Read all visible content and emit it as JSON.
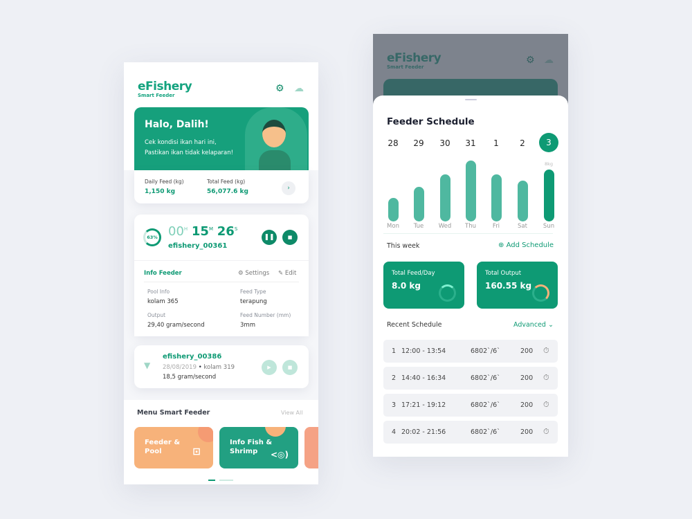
{
  "brand": {
    "name": "eFishery",
    "tagline": "Smart Feeder"
  },
  "colors": {
    "primary": "#0e9a74",
    "orange": "#f7b27a",
    "coral": "#f5a285"
  },
  "home": {
    "greeting": "Halo, Dalih!",
    "subtitle1": "Cek kondisi ikan hari ini,",
    "subtitle2": "Pastikan ikan tidak kelaparan!",
    "daily_feed_label": "Daily Feed (kg)",
    "daily_feed_value": "1,150 kg",
    "total_feed_label": "Total Feed (kg)",
    "total_feed_value": "56,077.6 kg",
    "active": {
      "progress": "63%",
      "hours": "00",
      "h": "H",
      "minutes": "15",
      "m": "M",
      "seconds": "26",
      "s": "S",
      "name": "efishery_00361"
    },
    "info": {
      "title": "Info Feeder",
      "settings": "Settings",
      "edit": "Edit",
      "pool_label": "Pool Info",
      "pool": "kolam 365",
      "type_label": "Feed Type",
      "type": "terapung",
      "output_label": "Output",
      "output": "29,40 gram/second",
      "number_label": "Feed Number (mm)",
      "number": "3mm"
    },
    "second": {
      "name": "efishery_00386",
      "date": "28/08/2019",
      "pool": "kolam 319",
      "rate": "18,5 gram/second"
    },
    "menu": {
      "title": "Menu Smart Feeder",
      "view_all": "View All",
      "tiles": [
        "Feeder & Pool",
        "Info Fish & Shrimp"
      ]
    }
  },
  "schedule": {
    "title": "Feeder Schedule",
    "dates": [
      "28",
      "29",
      "30",
      "31",
      "1",
      "2",
      "3"
    ],
    "selected_date": "3",
    "sun_label": "8kg",
    "this_week": "This week",
    "add": "Add Schedule",
    "total_feed_label": "Total Feed/Day",
    "total_feed": "8.0 kg",
    "total_output_label": "Total Output",
    "total_output": "160.55 kg",
    "recent": "Recent Schedule",
    "advanced": "Advanced",
    "rows": [
      {
        "n": "1",
        "time": "12:00 - 13:54",
        "code": "6802`/6`",
        "qty": "200"
      },
      {
        "n": "2",
        "time": "14:40 - 16:34",
        "code": "6802`/6`",
        "qty": "200"
      },
      {
        "n": "3",
        "time": "17:21 - 19:12",
        "code": "6802`/6`",
        "qty": "200"
      },
      {
        "n": "4",
        "time": "20:02 - 21:56",
        "code": "6802`/6`",
        "qty": "200"
      }
    ]
  },
  "chart_data": {
    "type": "bar",
    "categories": [
      "Mon",
      "Tue",
      "Wed",
      "Thu",
      "Fri",
      "Sat",
      "Sun"
    ],
    "values": [
      3.6,
      5.3,
      7.3,
      9.4,
      7.3,
      6.3,
      8
    ],
    "unit": "kg",
    "highlight": "Sun"
  }
}
